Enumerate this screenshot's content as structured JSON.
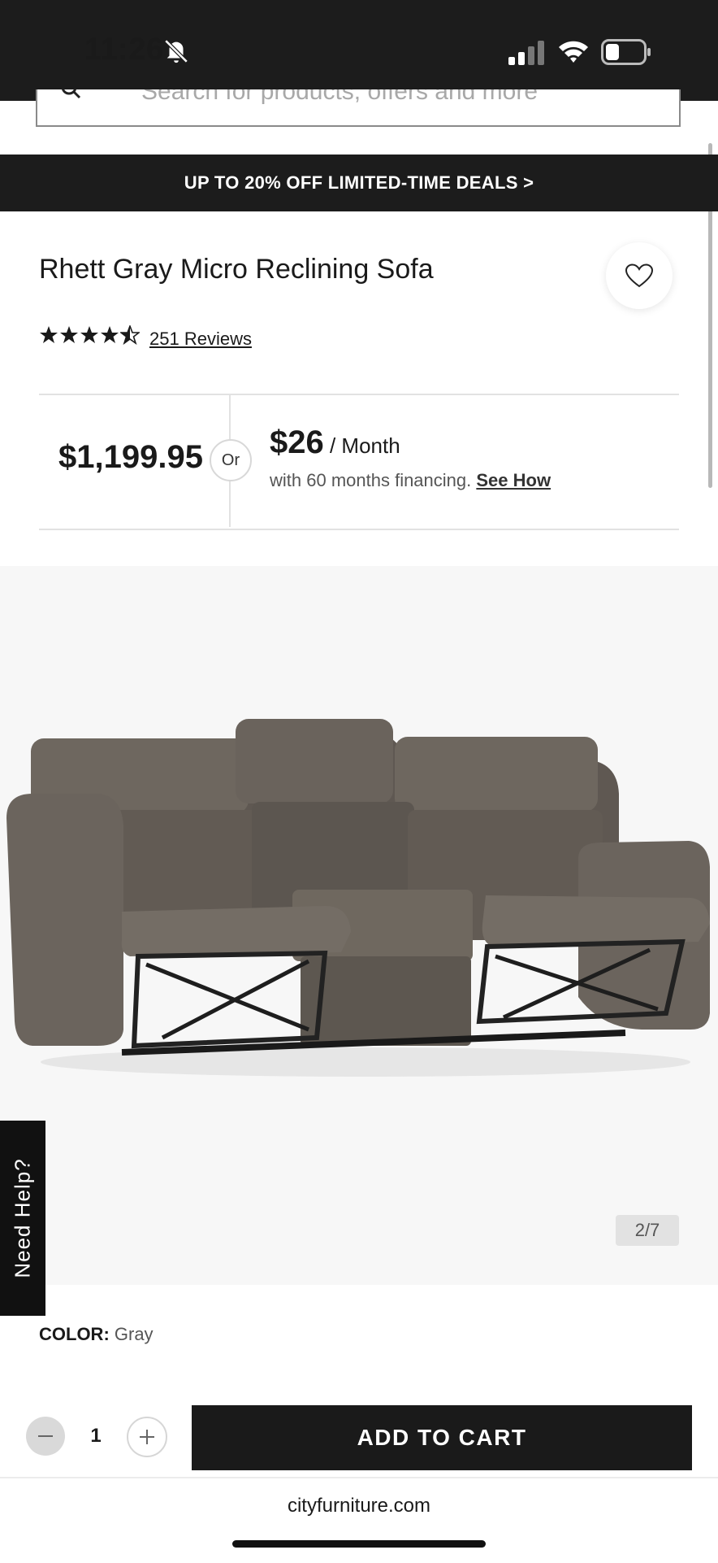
{
  "status_bar": {
    "time": "11:26"
  },
  "search": {
    "placeholder": "Search for products, offers and more"
  },
  "promo": {
    "text": "UP TO 20% OFF LIMITED-TIME DEALS >"
  },
  "product": {
    "title": "Rhett Gray Micro Reclining Sofa",
    "rating": 4.5,
    "reviews_label": "251 Reviews",
    "price": "$1,199.95",
    "or_label": "Or",
    "monthly_amount": "$26",
    "monthly_unit": " / Month",
    "financing_text": "with 60 months financing. ",
    "see_how_label": "See How",
    "image_counter": "2/7",
    "color_label": "COLOR:",
    "color_value": " Gray"
  },
  "help": {
    "label": "Need Help?"
  },
  "cart": {
    "quantity": "1",
    "add_label": "ADD TO CART"
  },
  "browser": {
    "url": "cityfurniture.com"
  },
  "colors": {
    "dark": "#1c1c1c",
    "sofa": "#6b645d",
    "accent_bg": "#f7f7f7"
  }
}
